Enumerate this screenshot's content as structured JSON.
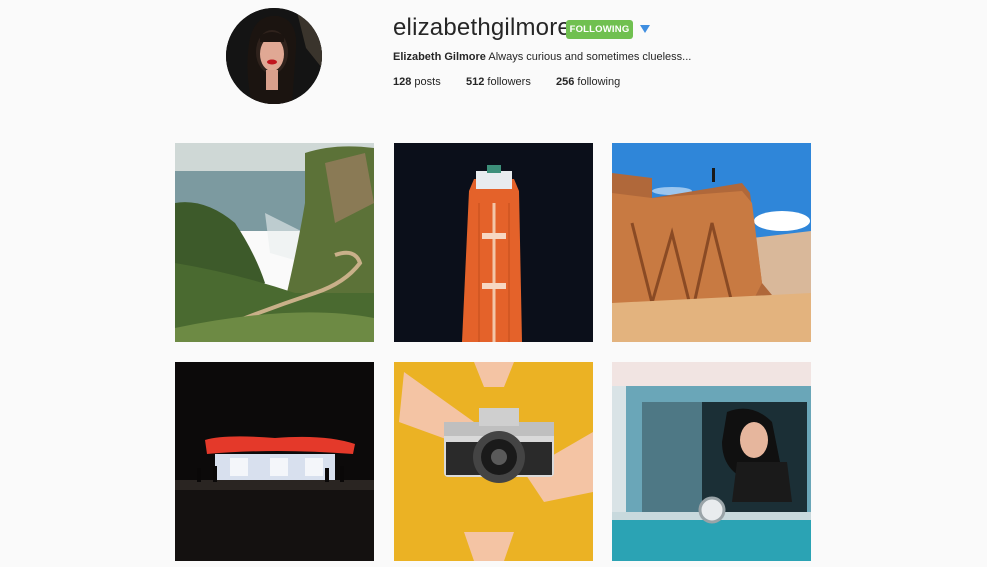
{
  "profile": {
    "username": "elizabethgilmore",
    "follow_label": "FOLLOWING",
    "full_name": "Elizabeth Gilmore",
    "bio": "Always curious and sometimes clueless...",
    "posts_count": "128",
    "posts_label": "posts",
    "followers_count": "512",
    "followers_label": "followers",
    "following_count": "256",
    "following_label": "following"
  },
  "colors": {
    "following_button": "#70c050",
    "dropdown_caret": "#3f8ee0",
    "background": "#fafafa"
  },
  "icons": {
    "dropdown": "caret-down-icon"
  },
  "posts": [
    {
      "subject": "coastal-cliff-trail"
    },
    {
      "subject": "aerial-tanker-ship"
    },
    {
      "subject": "person-on-rock-cliff"
    },
    {
      "subject": "gas-station-at-night"
    },
    {
      "subject": "hands-holding-camera"
    },
    {
      "subject": "woman-in-vintage-car"
    }
  ]
}
